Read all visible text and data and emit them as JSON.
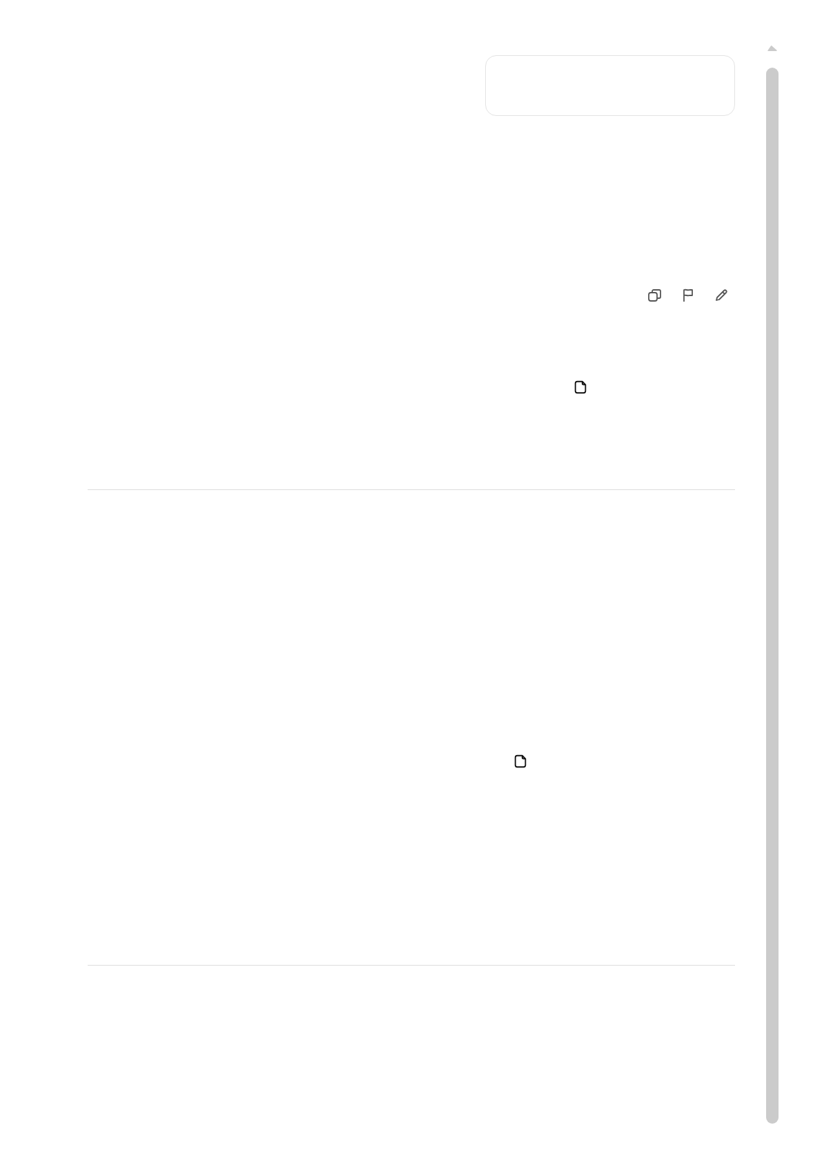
{
  "thread": [
    {
      "kind": "bubble"
    },
    {
      "kind": "actions"
    },
    {
      "kind": "note"
    },
    {
      "kind": "divider"
    },
    {
      "kind": "note"
    },
    {
      "kind": "divider"
    }
  ],
  "scrollbar": {
    "kind": "vertical"
  }
}
